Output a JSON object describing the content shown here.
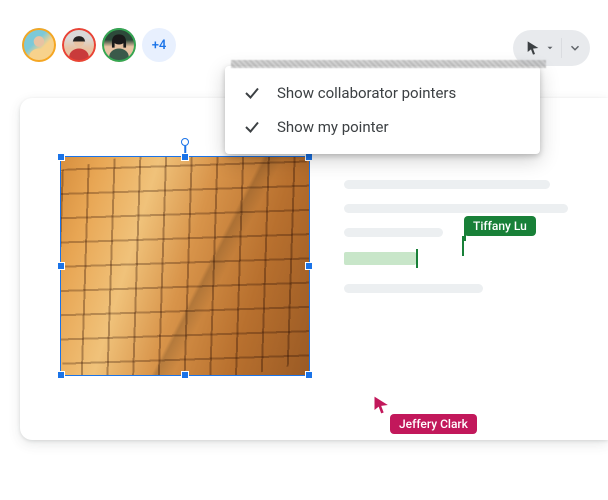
{
  "collaborators": {
    "more_count": "+4"
  },
  "pointer_menu": {
    "item1": {
      "label": "Show collaborator pointers",
      "checked": true
    },
    "item2": {
      "label": "Show my pointer",
      "checked": true
    }
  },
  "collab_tags": {
    "tiffany": "Tiffany Lu",
    "jeffery": "Jeffery Clark"
  },
  "colors": {
    "tiffany": "#188038",
    "jeffery": "#c2185b",
    "selection": "#1a73e8"
  }
}
